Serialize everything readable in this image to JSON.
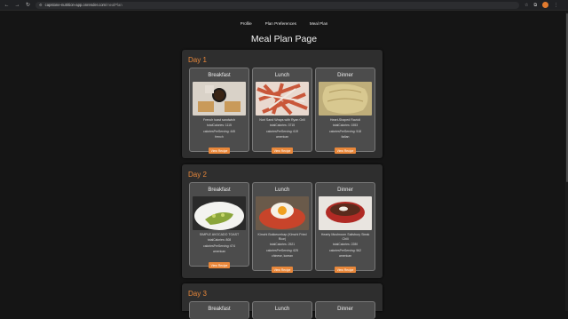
{
  "browser": {
    "url_host": "capstone-nutrition-app.onrender.com",
    "url_path": "/mealPlan",
    "back": "←",
    "forward": "→",
    "reload": "↻"
  },
  "nav": {
    "profile": "Profile",
    "plan_preferences": "Plan Preferences",
    "meal_plan": "Meal Plan"
  },
  "page_title": "Meal Plan Page",
  "days": [
    {
      "label": "Day 1",
      "meals": [
        {
          "type": "Breakfast",
          "recipe": "French toast sandwich",
          "stat1": "totalCalories: 1115",
          "stat2": "caloriesPerServing: 445",
          "cuisine": "french",
          "button": "View Recipe"
        },
        {
          "type": "Lunch",
          "recipe": "Nori Sand Wraps with Ryan Grill",
          "stat1": "totalCalories: 3715",
          "stat2": "caloriesPerServing: 619",
          "cuisine": "american",
          "button": "View Recipe"
        },
        {
          "type": "Dinner",
          "recipe": "Heart-Shaped Ravioli",
          "stat1": "totalCalories: 1553",
          "stat2": "caloriesPerServing: 518",
          "cuisine": "italian",
          "button": "View Recipe"
        }
      ]
    },
    {
      "label": "Day 2",
      "meals": [
        {
          "type": "Breakfast",
          "recipe": "SIMPLE AVOCADO TOAST",
          "stat1": "totalCalories: 808",
          "stat2": "caloriesPerServing: 674",
          "cuisine": "american",
          "button": "View Recipe"
        },
        {
          "type": "Lunch",
          "recipe": "Kimchi Bokkeumbap (Kimchi Fried Rice)",
          "stat1": "totalCalories: 2521",
          "stat2": "caloriesPerServing: 625",
          "cuisine": "chinese, korean",
          "button": "View Recipe"
        },
        {
          "type": "Dinner",
          "recipe": "Hearty Mushroom Salisbury Steak Chili",
          "stat1": "totalCalories: 2280",
          "stat2": "caloriesPerServing: 562",
          "cuisine": "american",
          "button": "View Recipe"
        }
      ]
    },
    {
      "label": "Day 3",
      "meals": [
        {
          "type": "Breakfast"
        },
        {
          "type": "Lunch"
        },
        {
          "type": "Dinner"
        }
      ]
    }
  ]
}
